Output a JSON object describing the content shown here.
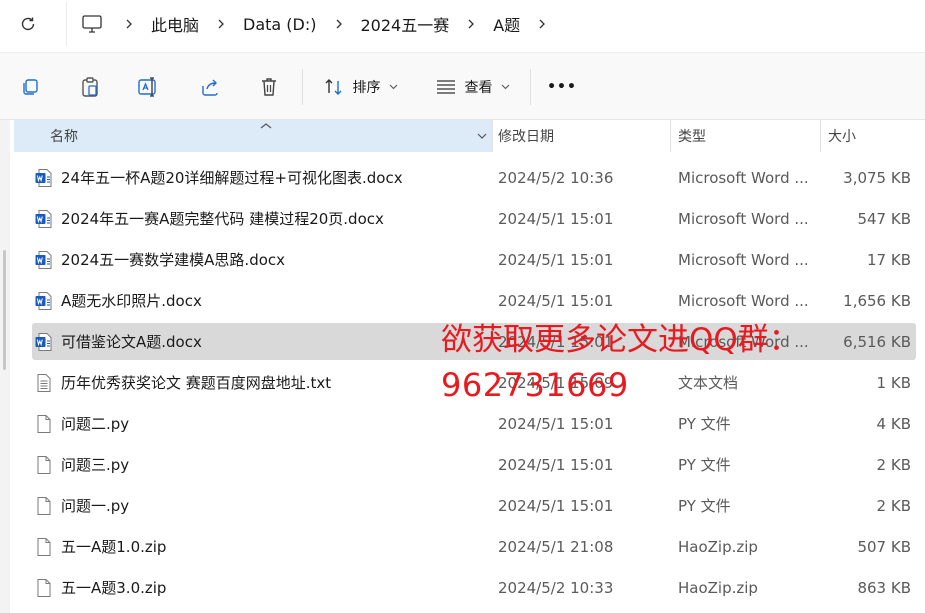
{
  "address": {
    "crumbs": [
      "此电脑",
      "Data (D:)",
      "2024五一赛",
      "A题"
    ]
  },
  "toolbar": {
    "sort_label": "排序",
    "view_label": "查看",
    "more_label": "•••"
  },
  "header": {
    "name": "名称",
    "date": "修改日期",
    "type": "类型",
    "size": "大小"
  },
  "files": [
    {
      "name": "24年五一杯A题20详细解题过程+可视化图表.docx",
      "date": "2024/5/2 10:36",
      "type": "Microsoft Word ...",
      "size": "3,075 KB",
      "icon": "word-icon"
    },
    {
      "name": "2024年五一赛A题完整代码 建模过程20页.docx",
      "date": "2024/5/1 15:01",
      "type": "Microsoft Word ...",
      "size": "547 KB",
      "icon": "word-icon"
    },
    {
      "name": "2024五一赛数学建模A思路.docx",
      "date": "2024/5/1 15:01",
      "type": "Microsoft Word ...",
      "size": "17 KB",
      "icon": "word-icon"
    },
    {
      "name": "A题无水印照片.docx",
      "date": "2024/5/1 15:01",
      "type": "Microsoft Word ...",
      "size": "1,656 KB",
      "icon": "word-icon"
    },
    {
      "name": "可借鉴论文A题.docx",
      "date": "2024/5/1 15:01",
      "type": "Microsoft Word ...",
      "size": "6,516 KB",
      "icon": "word-icon",
      "selected": true
    },
    {
      "name": "历年优秀获奖论文 赛题百度网盘地址.txt",
      "date": "2024/5/1 15:09",
      "type": "文本文档",
      "size": "1 KB",
      "icon": "text-file-icon"
    },
    {
      "name": "问题二.py",
      "date": "2024/5/1 15:01",
      "type": "PY 文件",
      "size": "4 KB",
      "icon": "blank-file-icon"
    },
    {
      "name": "问题三.py",
      "date": "2024/5/1 15:01",
      "type": "PY 文件",
      "size": "2 KB",
      "icon": "blank-file-icon"
    },
    {
      "name": "问题一.py",
      "date": "2024/5/1 15:01",
      "type": "PY 文件",
      "size": "2 KB",
      "icon": "blank-file-icon"
    },
    {
      "name": "五一A题1.0.zip",
      "date": "2024/5/1 21:08",
      "type": "HaoZip.zip",
      "size": "507 KB",
      "icon": "blank-file-icon"
    },
    {
      "name": "五一A题3.0.zip",
      "date": "2024/5/2 10:33",
      "type": "HaoZip.zip",
      "size": "863 KB",
      "icon": "blank-file-icon"
    }
  ],
  "watermark": {
    "line1": "欲获取更多论文进QQ群：",
    "line2": "962731669",
    "color": "#e8191f"
  },
  "colors": {
    "header_active": "#dcebf7",
    "selected_row": "#d9d9d9",
    "word_blue": "#185abd"
  }
}
